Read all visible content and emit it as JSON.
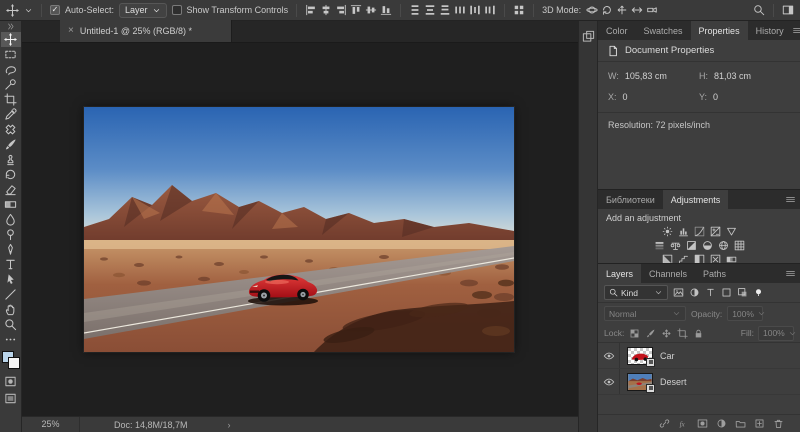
{
  "options_bar": {
    "auto_select_label": "Auto-Select:",
    "auto_select_value": "Layer",
    "check_glyph": "✓",
    "show_transform_label": "Show Transform Controls",
    "mode_3d_label": "3D Mode:",
    "align_icons": [
      "align-left",
      "align-center-h",
      "align-right",
      "align-top",
      "align-middle",
      "align-bottom"
    ],
    "distribute_icons": [
      "distribute-top",
      "distribute-middle",
      "distribute-bottom",
      "distribute-left",
      "distribute-center-h",
      "distribute-right"
    ],
    "mode3d_icons": [
      "orbit-3d",
      "roll-3d",
      "pan-3d",
      "slide-3d",
      "camera-3d"
    ]
  },
  "document_tab": {
    "close_glyph": "×",
    "title": "Untitled-1 @ 25% (RGB/8) *"
  },
  "tools": [
    "move",
    "marquee",
    "lasso",
    "quick-select",
    "crop",
    "eyedropper",
    "healing",
    "brush",
    "clone-stamp",
    "history-brush",
    "eraser",
    "gradient",
    "blur",
    "dodge",
    "pen",
    "type",
    "path-select",
    "line",
    "hand",
    "zoom",
    "ellipsis"
  ],
  "panels": {
    "properties": {
      "tabs": [
        "Color",
        "Swatches",
        "Properties",
        "History"
      ],
      "active_tab": "Properties",
      "header": "Document Properties",
      "fields": [
        {
          "label": "W:",
          "value": "105,83 cm"
        },
        {
          "label": "H:",
          "value": "81,03 cm"
        },
        {
          "label": "X:",
          "value": "0"
        },
        {
          "label": "Y:",
          "value": "0"
        }
      ],
      "resolution": "Resolution: 72 pixels/inch"
    },
    "adjustments": {
      "tabs": [
        "Библиотеки",
        "Adjustments"
      ],
      "active_tab": "Adjustments",
      "add_label": "Add an adjustment",
      "icon_rows": [
        [
          "brightness-contrast",
          "levels",
          "curves",
          "exposure",
          "vibrance"
        ],
        [
          "hue-saturation",
          "color-balance",
          "black-white",
          "photo-filter",
          "channel-mixer",
          "color-lookup"
        ],
        [
          "invert",
          "posterize",
          "threshold",
          "selective-color",
          "gradient-map"
        ]
      ]
    },
    "layers": {
      "tabs": [
        "Layers",
        "Channels",
        "Paths"
      ],
      "active_tab": "Layers",
      "filter_label": "Kind",
      "filter_icons": [
        "image-filter",
        "adjustment-filter",
        "type-filter",
        "shape-filter",
        "smart-object-filter"
      ],
      "blend_mode": "Normal",
      "opacity_label": "Opacity:",
      "opacity_value": "100%",
      "lock_label": "Lock:",
      "lock_icons": [
        "lock-transparent",
        "lock-paint",
        "lock-move",
        "lock-artboard",
        "lock-all"
      ],
      "fill_label": "Fill:",
      "fill_value": "100%",
      "items": [
        {
          "name": "Car",
          "thumb": "car"
        },
        {
          "name": "Desert",
          "thumb": "desert"
        }
      ],
      "bottom_icons": [
        "link-layers",
        "layer-effects",
        "layer-mask",
        "new-adjustment",
        "new-group",
        "new-layer",
        "delete-layer"
      ]
    }
  },
  "status_bar": {
    "zoom_level": "25%",
    "doc_size": "Doc: 14,8M/18,7M",
    "expand_glyph": "›"
  },
  "colors": {
    "chrome": "#3a3a3a",
    "workspace": "#1f1f1f",
    "panel": "#3e3e3e",
    "car_red": "#c1121c",
    "foreground_swatch": "#b9d4ea",
    "background_swatch": "#f5f5f5"
  }
}
